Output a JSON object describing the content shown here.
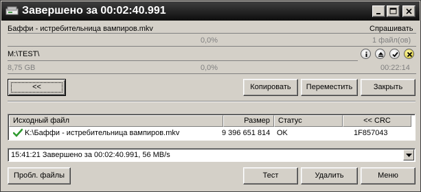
{
  "window": {
    "title": "Завершено за 00:02:40.991",
    "controls": [
      "minimize",
      "maximize",
      "close"
    ]
  },
  "source": {
    "file": "Баффи - истребительница вампиров.mkv",
    "mode": "Спрашивать",
    "percent": "0,0%",
    "count": "1 файл(ов)"
  },
  "destination": {
    "path": "M:\\TEST\\",
    "size": "8,75 GB",
    "percent": "0,0%",
    "time": "00:22:14",
    "icons": [
      "info-icon",
      "eject-icon",
      "check-icon",
      "cancel-icon"
    ]
  },
  "buttons": {
    "back": "<<",
    "copy": "Копировать",
    "move": "Переместить",
    "close": "Закрыть",
    "problem_files": "Пробл. файлы",
    "test": "Тест",
    "delete": "Удалить",
    "menu": "Меню"
  },
  "table": {
    "columns": [
      "Исходный файл",
      "Размер",
      "Статус",
      "<< CRC"
    ],
    "rows": [
      {
        "file": "K:\\Баффи - истребительница вампиров.mkv",
        "size": "9 396 651 814",
        "status": "OK",
        "crc": "1F857043"
      }
    ]
  },
  "log": {
    "line": "15:41:21 Завершено за 00:02:40.991, 56 MB/s"
  },
  "colors": {
    "titlebar": "#0d0d0d",
    "face": "#d4d0c8",
    "accent_check": "#2e9a2e"
  }
}
